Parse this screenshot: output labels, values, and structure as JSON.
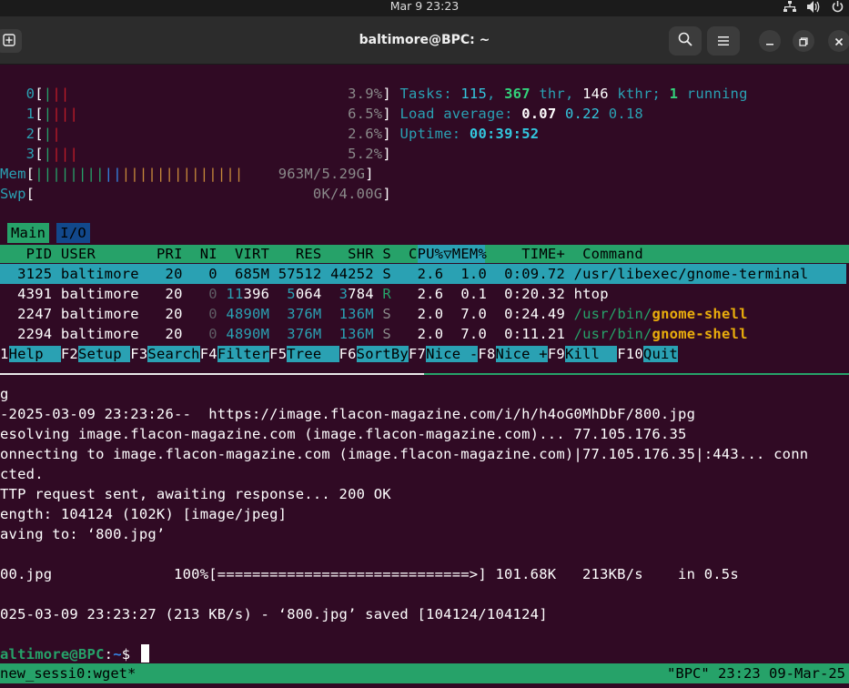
{
  "topbar": {
    "clock": "Mar 9  23:23",
    "icons": [
      "network-icon",
      "volume-icon",
      "power-icon"
    ]
  },
  "window": {
    "title": "baltimore@BPC: ~",
    "buttons": [
      "new-tab",
      "search",
      "menu",
      "minimize",
      "maximize",
      "close"
    ]
  },
  "htop": {
    "cpus": [
      {
        "id": "0",
        "bars": "|||",
        "pct": "3.9%",
        "bar_colors": [
          "#26a269",
          "#c01c28",
          "#c01c28"
        ]
      },
      {
        "id": "1",
        "bars": "||||",
        "pct": "6.5%",
        "bar_colors": [
          "#26a269",
          "#c01c28",
          "#c01c28",
          "#c01c28"
        ]
      },
      {
        "id": "2",
        "bars": "||",
        "pct": "2.6%",
        "bar_colors": [
          "#26a269",
          "#c01c28"
        ]
      },
      {
        "id": "3",
        "bars": "||||",
        "pct": "5.2%",
        "bar_colors": [
          "#26a269",
          "#c01c28",
          "#c01c28",
          "#c01c28"
        ]
      }
    ],
    "mem": {
      "label": "Mem",
      "bars_green": "||||||||",
      "bars_blue": "||",
      "bars_orange": "||||||||||||||",
      "value": "963M/5.29G"
    },
    "swp": {
      "label": "Swp",
      "value": "0K/4.00G"
    },
    "tasks": {
      "label": "Tasks:",
      "count": "115",
      "thr": "367",
      "thr_label": "thr,",
      "kthr": "146",
      "kthr_label": "kthr;",
      "running": "1",
      "running_label": "running"
    },
    "load": {
      "label": "Load average:",
      "v1": "0.07",
      "v5": "0.22",
      "v15": "0.18"
    },
    "uptime": {
      "label": "Uptime:",
      "value": "00:39:52"
    },
    "tabs": [
      "Main",
      "I/O"
    ],
    "columns": [
      "PID",
      "USER",
      "PRI",
      "NI",
      "VIRT",
      "RES",
      "SHR",
      "S",
      "CPU%▽",
      "MEM%",
      "TIME+",
      "Command"
    ],
    "processes": [
      {
        "pid": "3125",
        "user": "baltimore",
        "pri": "20",
        "ni": "0",
        "virt": "685M",
        "res": "57512",
        "shr": "44252",
        "s": "S",
        "cpu": "2.6",
        "mem": "1.0",
        "time": "0:09.72",
        "cmd": "/usr/libexec/gnome-terminal"
      },
      {
        "pid": "4391",
        "user": "baltimore",
        "pri": "20",
        "ni": "0",
        "virt_hi": "11",
        "virt": "396",
        "res_hi": "5",
        "res": "064",
        "shr_hi": "3",
        "shr": "784",
        "s": "R",
        "cpu": "2.6",
        "mem": "0.1",
        "time": "0:20.32",
        "cmd": "htop"
      },
      {
        "pid": "2247",
        "user": "baltimore",
        "pri": "20",
        "ni": "0",
        "virt": "4890M",
        "res": "376M",
        "shr": "136M",
        "s": "S",
        "cpu": "2.0",
        "mem": "7.0",
        "time": "0:24.49",
        "cmd_dir": "/usr/bin/",
        "cmd_name": "gnome-shell"
      },
      {
        "pid": "2294",
        "user": "baltimore",
        "pri": "20",
        "ni": "0",
        "virt": "4890M",
        "res": "376M",
        "shr": "136M",
        "s": "S",
        "cpu": "2.0",
        "mem": "7.0",
        "time": "0:11.21",
        "cmd_dir": "/usr/bin/",
        "cmd_name": "gnome-shell"
      }
    ],
    "fkeys": [
      {
        "key": "1",
        "label": "Help  "
      },
      {
        "key": "F2",
        "label": "Setup "
      },
      {
        "key": "F3",
        "label": "Search"
      },
      {
        "key": "F4",
        "label": "Filter"
      },
      {
        "key": "F5",
        "label": "Tree  "
      },
      {
        "key": "F6",
        "label": "SortBy"
      },
      {
        "key": "F7",
        "label": "Nice -"
      },
      {
        "key": "F8",
        "label": "Nice +"
      },
      {
        "key": "F9",
        "label": "Kill  "
      },
      {
        "key": "F10",
        "label": "Quit"
      }
    ]
  },
  "wget": {
    "lines": [
      "g",
      "-2025-03-09 23:23:26--  https://image.flacon-magazine.com/i/h/h4oG0MhDbF/800.jpg",
      "esolving image.flacon-magazine.com (image.flacon-magazine.com)... 77.105.176.35",
      "onnecting to image.flacon-magazine.com (image.flacon-magazine.com)|77.105.176.35|:443... conn",
      "cted.",
      "TTP request sent, awaiting response... 200 OK",
      "ength: 104124 (102K) [image/jpeg]",
      "aving to: ‘800.jpg’",
      "",
      "00.jpg              100%[=============================>] 101.68K   213KB/s    in 0.5s",
      "",
      "025-03-09 23:23:27 (213 KB/s) - ‘800.jpg’ saved [104124/104124]",
      ""
    ],
    "prompt_user": "altimore@BPC",
    "prompt_path": "~",
    "prompt_symbol": "$ "
  },
  "tmux": {
    "left": "new_sessi0:wget*",
    "right": "\"BPC\" 23:23 09-Mar-25"
  }
}
